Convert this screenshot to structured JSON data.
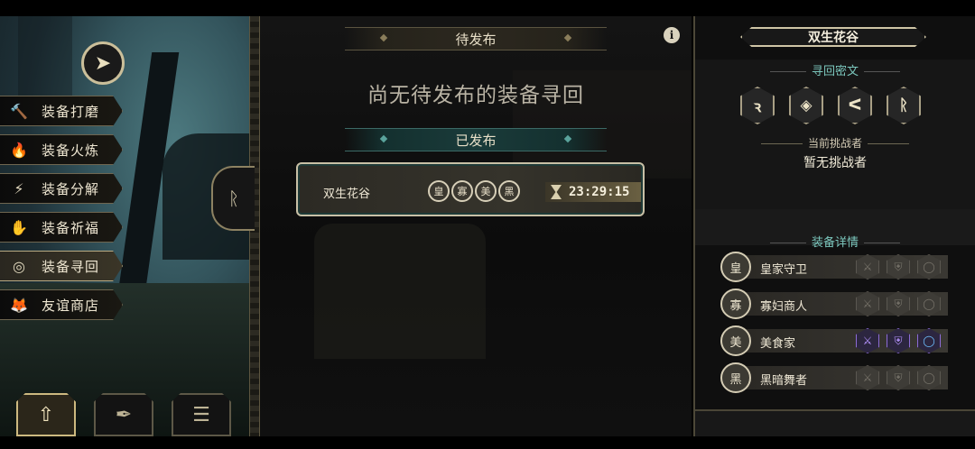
{
  "menu": {
    "items": [
      {
        "label": "装备打磨",
        "icon": "hammer-icon",
        "glyph": "🔨",
        "active": false
      },
      {
        "label": "装备火炼",
        "icon": "flame-icon",
        "glyph": "🔥",
        "active": false
      },
      {
        "label": "装备分解",
        "icon": "disassemble-icon",
        "glyph": "⚡",
        "active": false
      },
      {
        "label": "装备祈福",
        "icon": "pray-icon",
        "glyph": "✋",
        "active": false
      },
      {
        "label": "装备寻回",
        "icon": "recover-icon",
        "glyph": "◎",
        "active": true
      },
      {
        "label": "友谊商店",
        "icon": "fox-icon",
        "glyph": "🦊",
        "active": false
      }
    ]
  },
  "bottom_tabs": [
    {
      "icon": "upload-icon",
      "glyph": "⇧",
      "active": true
    },
    {
      "icon": "feather-icon",
      "glyph": "✒",
      "active": false
    },
    {
      "icon": "list-icon",
      "glyph": "☰",
      "active": false
    }
  ],
  "middle": {
    "pending_header": "待发布",
    "empty_message": "尚无待发布的装备寻回",
    "published_header": "已发布",
    "quest": {
      "name": "双生花谷",
      "avatars": [
        "皇",
        "寡",
        "美",
        "黑"
      ],
      "timer": "23:29:15"
    }
  },
  "right": {
    "title": "双生花谷",
    "cipher_label": "寻回密文",
    "runes": [
      "ꝛ",
      "◈",
      "ᐸ",
      "ᚱ"
    ],
    "challenger_label": "当前挑战者",
    "challenger_value": "暂无挑战者",
    "details_label": "装备详情",
    "details": [
      {
        "name": "皇家守卫",
        "avatar": "皇",
        "slots": [
          {
            "glyph": "⚔",
            "filled": false
          },
          {
            "glyph": "⛨",
            "filled": false
          },
          {
            "glyph": "◯",
            "filled": false
          }
        ]
      },
      {
        "name": "寡妇商人",
        "avatar": "寡",
        "slots": [
          {
            "glyph": "⚔",
            "filled": false
          },
          {
            "glyph": "⛨",
            "filled": false
          },
          {
            "glyph": "◯",
            "filled": false
          }
        ]
      },
      {
        "name": "美食家",
        "avatar": "美",
        "slots": [
          {
            "glyph": "⚔",
            "filled": true
          },
          {
            "glyph": "⛨",
            "filled": true
          },
          {
            "glyph": "◯",
            "filled": true
          }
        ]
      },
      {
        "name": "黑暗舞者",
        "avatar": "黑",
        "slots": [
          {
            "glyph": "⚔",
            "filled": false
          },
          {
            "glyph": "⛨",
            "filled": false
          },
          {
            "glyph": "◯",
            "filled": false
          }
        ]
      }
    ]
  }
}
